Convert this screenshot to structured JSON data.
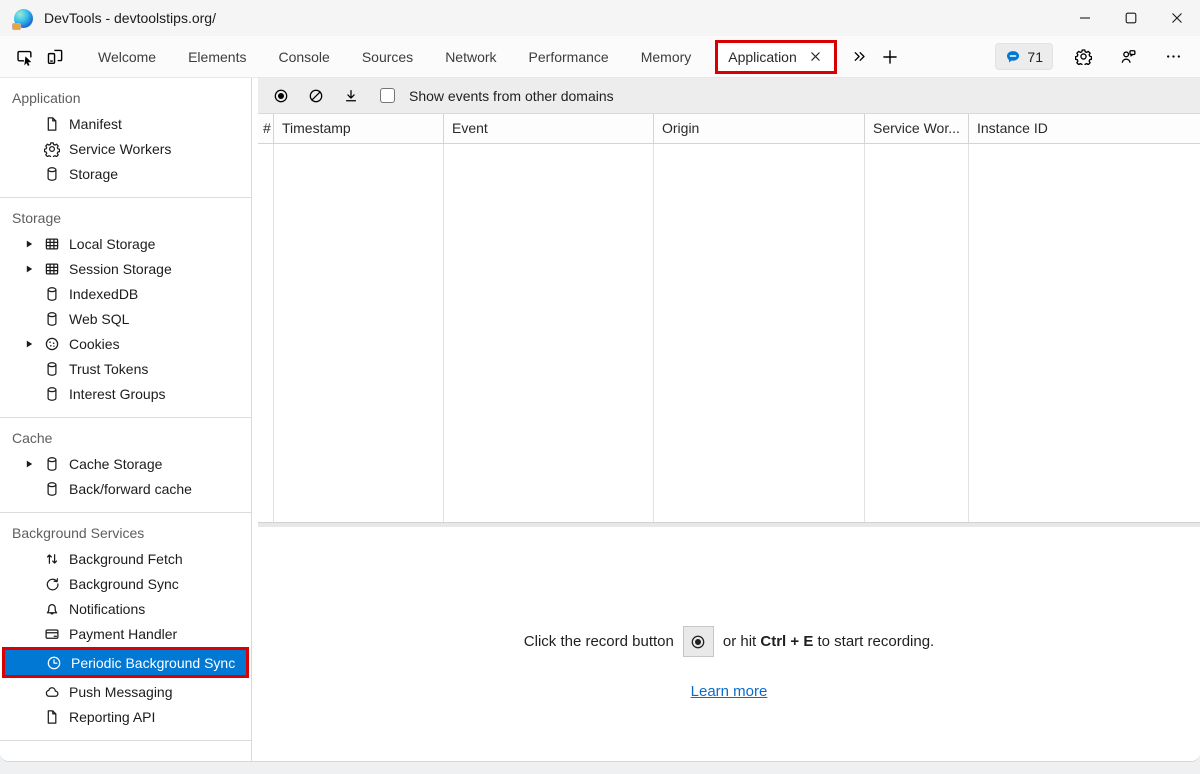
{
  "window": {
    "title": "DevTools - devtoolstips.org/"
  },
  "titlebar": {
    "app_icon": "edge-logo-icon",
    "control_icons": [
      "minimize-icon",
      "maximize-icon",
      "close-icon"
    ]
  },
  "tabbar": {
    "left_icons": [
      "inspect-icon",
      "device-emulation-icon"
    ],
    "tabs": [
      {
        "label": "Welcome"
      },
      {
        "label": "Elements"
      },
      {
        "label": "Console"
      },
      {
        "label": "Sources"
      },
      {
        "label": "Network"
      },
      {
        "label": "Performance"
      },
      {
        "label": "Memory"
      },
      {
        "label": "Application",
        "active": true,
        "closable": true,
        "annotated": true
      }
    ],
    "overflow_icon": "chevron-double-right-icon",
    "add_tab_icon": "plus-icon",
    "chat_badge": {
      "count": "71",
      "icon": "chat-bubble-icon"
    },
    "right_icons": [
      "settings-gear-icon",
      "feedback-icon",
      "more-options-icon"
    ]
  },
  "sidebar": {
    "sections": [
      {
        "title": "Application",
        "items": [
          {
            "label": "Manifest",
            "icon": "document-icon"
          },
          {
            "label": "Service Workers",
            "icon": "gear-icon"
          },
          {
            "label": "Storage",
            "icon": "database-icon"
          }
        ]
      },
      {
        "title": "Storage",
        "items": [
          {
            "label": "Local Storage",
            "icon": "table-icon",
            "expandable": true
          },
          {
            "label": "Session Storage",
            "icon": "table-icon",
            "expandable": true
          },
          {
            "label": "IndexedDB",
            "icon": "database-icon"
          },
          {
            "label": "Web SQL",
            "icon": "database-icon"
          },
          {
            "label": "Cookies",
            "icon": "cookie-icon",
            "expandable": true
          },
          {
            "label": "Trust Tokens",
            "icon": "database-icon"
          },
          {
            "label": "Interest Groups",
            "icon": "database-icon"
          }
        ]
      },
      {
        "title": "Cache",
        "items": [
          {
            "label": "Cache Storage",
            "icon": "database-icon",
            "expandable": true
          },
          {
            "label": "Back/forward cache",
            "icon": "database-icon"
          }
        ]
      },
      {
        "title": "Background Services",
        "items": [
          {
            "label": "Background Fetch",
            "icon": "arrows-up-down-icon"
          },
          {
            "label": "Background Sync",
            "icon": "sync-icon"
          },
          {
            "label": "Notifications",
            "icon": "bell-icon"
          },
          {
            "label": "Payment Handler",
            "icon": "payment-card-icon"
          },
          {
            "label": "Periodic Background Sync",
            "icon": "clock-icon",
            "selected": true,
            "annotated": true
          },
          {
            "label": "Push Messaging",
            "icon": "cloud-icon"
          },
          {
            "label": "Reporting API",
            "icon": "document-icon"
          }
        ]
      }
    ]
  },
  "panel_toolbar": {
    "button_icons": [
      "record-icon",
      "clear-icon",
      "download-icon"
    ],
    "checkbox_label": "Show events from other domains",
    "checkbox_checked": false
  },
  "table": {
    "columns": [
      "#",
      "Timestamp",
      "Event",
      "Origin",
      "Service Wor...",
      "Instance ID"
    ],
    "rows": []
  },
  "empty_state": {
    "prefix": "Click the record button",
    "middle": "or hit",
    "shortcut": "Ctrl + E",
    "suffix": "to start recording.",
    "record_icon": "record-icon",
    "link_label": "Learn more"
  },
  "colors": {
    "selection_blue": "#0078d4",
    "annotation_red": "#d80000",
    "link_blue": "#0b6cce",
    "chat_icon_blue": "#0078d4"
  }
}
